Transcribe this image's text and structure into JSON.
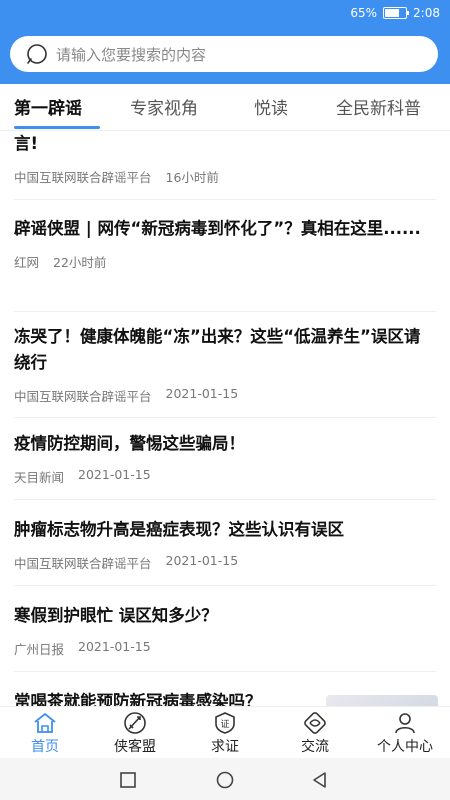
{
  "status_bar": {
    "battery": "65%",
    "battery_level": 0.65,
    "time": "2:08"
  },
  "search": {
    "placeholder": "请输入您要搜索的内容"
  },
  "tabs": [
    {
      "label": "第一辟谣",
      "active": true
    },
    {
      "label": "专家视角",
      "active": false
    },
    {
      "label": "悦读",
      "active": false
    },
    {
      "label": "全民新科普",
      "active": false
    }
  ],
  "articles": [
    {
      "title": "言!",
      "source": "中国互联网联合辟谣平台",
      "time": "16小时前"
    },
    {
      "title": "辟谣侠盟 | 网传“新冠病毒到怀化了”？真相在这里......",
      "source": "红网",
      "time": "22小时前"
    },
    {
      "title": "冻哭了！健康体魄能“冻”出来？这些“低温养生”误区请绕行",
      "source": "中国互联网联合辟谣平台",
      "time": "2021-01-15"
    },
    {
      "title": "疫情防控期间，警惕这些骗局！",
      "source": "天目新闻",
      "time": "2021-01-15"
    },
    {
      "title": "肿瘤标志物升高是癌症表现？这些认识有误区",
      "source": "中国互联网联合辟谣平台",
      "time": "2021-01-15"
    },
    {
      "title": "寒假到护眼忙 误区知多少？",
      "source": "广州日报",
      "time": "2021-01-15"
    },
    {
      "title": "常喝茶就能预防新冠病毒感染吗？",
      "source": "",
      "time": ""
    }
  ],
  "bottom_nav": [
    {
      "label": "首页",
      "icon": "home-icon",
      "active": true
    },
    {
      "label": "侠客盟",
      "icon": "sword-icon",
      "active": false
    },
    {
      "label": "求证",
      "icon": "verify-badge-icon",
      "active": false
    },
    {
      "label": "交流",
      "icon": "exchange-icon",
      "active": false
    },
    {
      "label": "个人中心",
      "icon": "user-icon",
      "active": false
    }
  ],
  "colors": {
    "accent": "#3d8ff0"
  }
}
